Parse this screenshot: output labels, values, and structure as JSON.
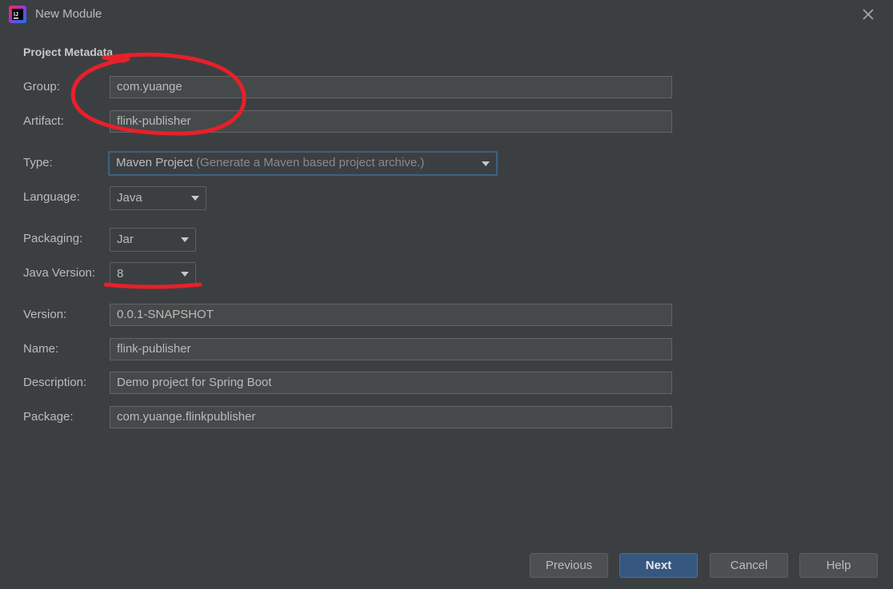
{
  "window": {
    "title": "New Module"
  },
  "section_title": "Project Metadata",
  "fields": {
    "group": {
      "label": "Group:",
      "value": "com.yuange"
    },
    "artifact": {
      "label": "Artifact:",
      "value": "flink-publisher"
    },
    "type": {
      "label": "Type:",
      "value": "Maven Project",
      "hint": "(Generate a Maven based project archive.)"
    },
    "language": {
      "label": "Language:",
      "value": "Java"
    },
    "packaging": {
      "label": "Packaging:",
      "value": "Jar"
    },
    "java_version": {
      "label": "Java Version:",
      "value": "8"
    },
    "version": {
      "label": "Version:",
      "value": "0.0.1-SNAPSHOT"
    },
    "name": {
      "label": "Name:",
      "value": "flink-publisher"
    },
    "description": {
      "label": "Description:",
      "value": "Demo project for Spring Boot"
    },
    "package": {
      "label": "Package:",
      "value": "com.yuange.flinkpublisher"
    }
  },
  "buttons": {
    "previous": "Previous",
    "next": "Next",
    "cancel": "Cancel",
    "help": "Help"
  },
  "icons": {
    "app": "intellij-idea-icon",
    "close": "close-icon",
    "dropdown": "chevron-down-icon"
  },
  "colors": {
    "background": "#3c3f41",
    "field_bg": "#45494a",
    "primary_button": "#365880",
    "focus_border": "#3d6185",
    "annotation": "#e8202a"
  }
}
